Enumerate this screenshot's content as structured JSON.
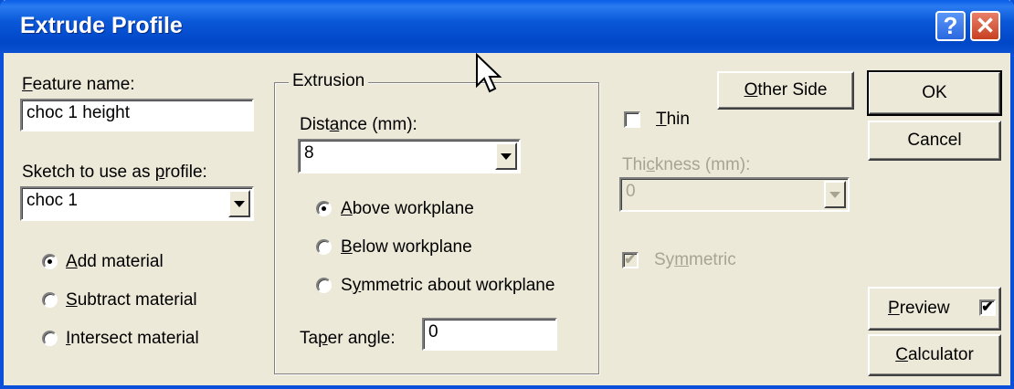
{
  "window": {
    "title": "Extrude Profile",
    "help_glyph": "?",
    "close_glyph": "✕"
  },
  "feature_name": {
    "label_key": "F",
    "label_rest": "eature name:",
    "value": "choc 1 height"
  },
  "sketch": {
    "label_pre": "Sketch to use as ",
    "label_key": "p",
    "label_post": "rofile:",
    "value": "choc 1"
  },
  "material": {
    "options": [
      {
        "pre": "",
        "key": "A",
        "post": "dd material",
        "checked": true
      },
      {
        "pre": "",
        "key": "S",
        "post": "ubtract material",
        "checked": false
      },
      {
        "pre": "",
        "key": "I",
        "post": "ntersect material",
        "checked": false
      }
    ]
  },
  "extrusion": {
    "group_title": "Extrusion",
    "distance_label_pre": "Dist",
    "distance_label_key": "a",
    "distance_label_post": "nce (mm):",
    "distance_value": "8",
    "options": [
      {
        "pre": "",
        "key": "A",
        "post": "bove workplane",
        "checked": true
      },
      {
        "pre": "",
        "key": "B",
        "post": "elow workplane",
        "checked": false
      },
      {
        "pre": "S",
        "key": "y",
        "post": "mmetric about workplane",
        "checked": false
      }
    ],
    "taper_label_pre": "Ta",
    "taper_label_key": "p",
    "taper_label_post": "er angle:",
    "taper_value": "0"
  },
  "thin": {
    "label_key": "T",
    "label_rest": "hin",
    "checked": false,
    "thickness_label_pre": "Thi",
    "thickness_label_key": "c",
    "thickness_label_post": "kness (mm):",
    "thickness_value": "0",
    "symmetric_pre": "Sy",
    "symmetric_key": "m",
    "symmetric_post": "metric",
    "symmetric_checked": true,
    "disabled": true
  },
  "buttons": {
    "other_side_key": "O",
    "other_side_rest": "ther Side",
    "ok": "OK",
    "cancel": "Cancel",
    "preview_key": "P",
    "preview_rest": "review",
    "preview_checked": true,
    "calculator_key": "C",
    "calculator_rest": "alculator"
  },
  "colors": {
    "titlebar": "#0a50d8",
    "dialog_bg": "#ece9d8",
    "disabled_text": "#a7a592"
  },
  "check_glyph": "✔"
}
